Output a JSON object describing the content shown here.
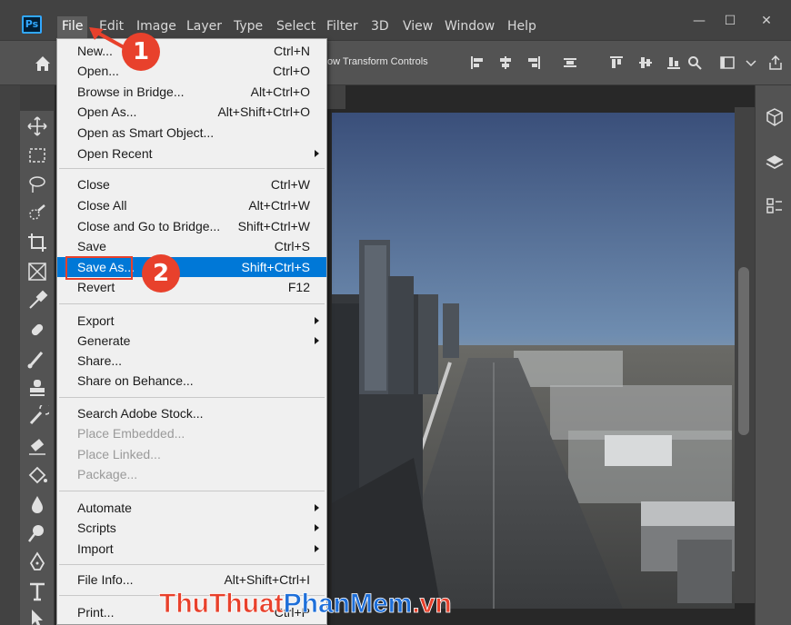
{
  "app": {
    "logo": "Ps"
  },
  "menubar": {
    "items": [
      "File",
      "Edit",
      "Image",
      "Layer",
      "Type",
      "Select",
      "Filter",
      "3D",
      "View",
      "Window",
      "Help"
    ],
    "window_buttons": {
      "minimize": "—",
      "maximize": "☐",
      "close": "✕"
    }
  },
  "optionsbar": {
    "show_transform": "ow Transform Controls"
  },
  "file_menu": {
    "items": [
      {
        "label": "New...",
        "shortcut": "Ctrl+N"
      },
      {
        "label": "Open...",
        "shortcut": "Ctrl+O"
      },
      {
        "label": "Browse in Bridge...",
        "shortcut": "Alt+Ctrl+O"
      },
      {
        "label": "Open As...",
        "shortcut": "Alt+Shift+Ctrl+O"
      },
      {
        "label": "Open as Smart Object...",
        "shortcut": ""
      },
      {
        "label": "Open Recent",
        "shortcut": ""
      },
      {
        "label": "Close",
        "shortcut": "Ctrl+W"
      },
      {
        "label": "Close All",
        "shortcut": "Alt+Ctrl+W"
      },
      {
        "label": "Close and Go to Bridge...",
        "shortcut": "Shift+Ctrl+W"
      },
      {
        "label": "Save",
        "shortcut": "Ctrl+S"
      },
      {
        "label": "Save As...",
        "shortcut": "Shift+Ctrl+S"
      },
      {
        "label": "Revert",
        "shortcut": "F12"
      },
      {
        "label": "Export",
        "shortcut": ""
      },
      {
        "label": "Generate",
        "shortcut": ""
      },
      {
        "label": "Share...",
        "shortcut": ""
      },
      {
        "label": "Share on Behance...",
        "shortcut": ""
      },
      {
        "label": "Search Adobe Stock...",
        "shortcut": ""
      },
      {
        "label": "Place Embedded...",
        "shortcut": ""
      },
      {
        "label": "Place Linked...",
        "shortcut": ""
      },
      {
        "label": "Package...",
        "shortcut": ""
      },
      {
        "label": "Automate",
        "shortcut": ""
      },
      {
        "label": "Scripts",
        "shortcut": ""
      },
      {
        "label": "Import",
        "shortcut": ""
      },
      {
        "label": "File Info...",
        "shortcut": "Alt+Shift+Ctrl+I"
      },
      {
        "label": "Print...",
        "shortcut": "Ctrl+P"
      }
    ]
  },
  "annotations": {
    "step1": "1",
    "step2": "2"
  },
  "watermark": {
    "part1": "ThuThuat",
    "part2": "PhanMem",
    "part3": ".vn"
  },
  "colors": {
    "highlight": "#0078d7",
    "badge": "#e8412c",
    "watermark_red": "#e8412c",
    "watermark_blue": "#1e6fd9"
  }
}
